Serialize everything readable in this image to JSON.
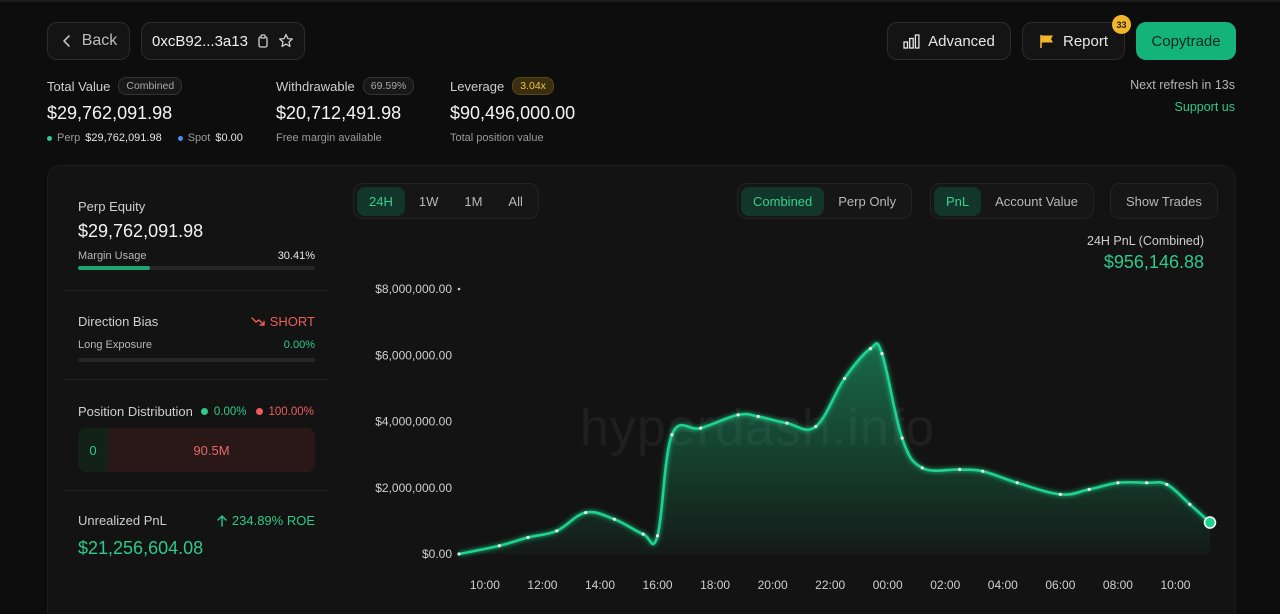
{
  "header": {
    "back_label": "Back",
    "address": "0xcB92...3a13",
    "advanced_label": "Advanced",
    "report_label": "Report",
    "report_badge": "33",
    "copytrade_label": "Copytrade"
  },
  "stats": {
    "total_value": {
      "label": "Total Value",
      "pill": "Combined",
      "value": "$29,762,091.98",
      "perp_label": "Perp",
      "perp_value": "$29,762,091.98",
      "spot_label": "Spot",
      "spot_value": "$0.00"
    },
    "withdrawable": {
      "label": "Withdrawable",
      "pill": "69.59%",
      "value": "$20,712,491.98",
      "sub": "Free margin available"
    },
    "leverage": {
      "label": "Leverage",
      "pill": "3.04x",
      "value": "$90,496,000.00",
      "sub": "Total position value"
    },
    "refresh": "Next refresh in 13s",
    "support": "Support us"
  },
  "sidebar": {
    "perp_equity_label": "Perp Equity",
    "perp_equity_value": "$29,762,091.98",
    "margin_usage_label": "Margin Usage",
    "margin_usage_value": "30.41%",
    "margin_usage_fraction": 0.3041,
    "direction_bias_label": "Direction Bias",
    "direction_bias_value": "SHORT",
    "long_exposure_label": "Long Exposure",
    "long_exposure_value": "0.00%",
    "long_exposure_fraction": 0.0,
    "position_distribution_label": "Position Distribution",
    "long_pct": "0.00%",
    "short_pct": "100.00%",
    "long_amount": "0",
    "short_amount": "90.5M",
    "unrealized_pnl_label": "Unrealized PnL",
    "roe": "234.89% ROE",
    "unrealized_pnl_value": "$21,256,604.08"
  },
  "chart_controls": {
    "ranges": [
      "24H",
      "1W",
      "1M",
      "All"
    ],
    "active_range": "24H",
    "modes": [
      "Combined",
      "Perp Only"
    ],
    "active_mode": "Combined",
    "metrics": [
      "PnL",
      "Account Value"
    ],
    "active_metric": "PnL",
    "show_trades_label": "Show Trades",
    "pnl_label": "24H PnL (Combined)",
    "pnl_value": "$956,146.88",
    "watermark": "hyperdash.info"
  },
  "colors": {
    "accent": "#2ec98b",
    "short": "#ee5d5d",
    "line": "#1fd38f",
    "warning": "#f2b62a"
  },
  "chart_data": {
    "type": "area",
    "y_tick_labels": [
      "$0.00",
      "$2,000,000.00",
      "$4,000,000.00",
      "$6,000,000.00",
      "$8,000,000.00"
    ],
    "y_ticks": [
      0,
      2000000,
      4000000,
      6000000,
      8000000
    ],
    "ylim": [
      0,
      8000000
    ],
    "x_tick_labels": [
      "10:00",
      "12:00",
      "14:00",
      "16:00",
      "18:00",
      "20:00",
      "22:00",
      "00:00",
      "02:00",
      "04:00",
      "06:00",
      "08:00",
      "10:00"
    ],
    "x_ticks": [
      10,
      12,
      14,
      16,
      18,
      20,
      22,
      24,
      26,
      28,
      30,
      32,
      34
    ],
    "xlim": [
      9.1,
      35.2
    ],
    "grid": false,
    "series": [
      {
        "x": [
          9.1,
          10.5,
          11.5,
          12.5,
          13.5,
          14.5,
          15.5,
          16.0,
          16.5,
          17.5,
          18.8,
          19.5,
          20.5,
          21.5,
          22.5,
          23.4,
          23.8,
          24.5,
          25.2,
          26.5,
          27.3,
          28.5,
          30.0,
          31.0,
          32.0,
          33.0,
          33.7,
          34.5,
          35.2
        ],
        "y": [
          0,
          250000,
          500000,
          700000,
          1250000,
          1050000,
          600000,
          550000,
          3600000,
          3800000,
          4200000,
          4150000,
          3950000,
          3850000,
          5300000,
          6200000,
          6050000,
          3500000,
          2600000,
          2550000,
          2500000,
          2150000,
          1800000,
          1950000,
          2150000,
          2150000,
          2100000,
          1500000,
          950000
        ]
      }
    ]
  }
}
